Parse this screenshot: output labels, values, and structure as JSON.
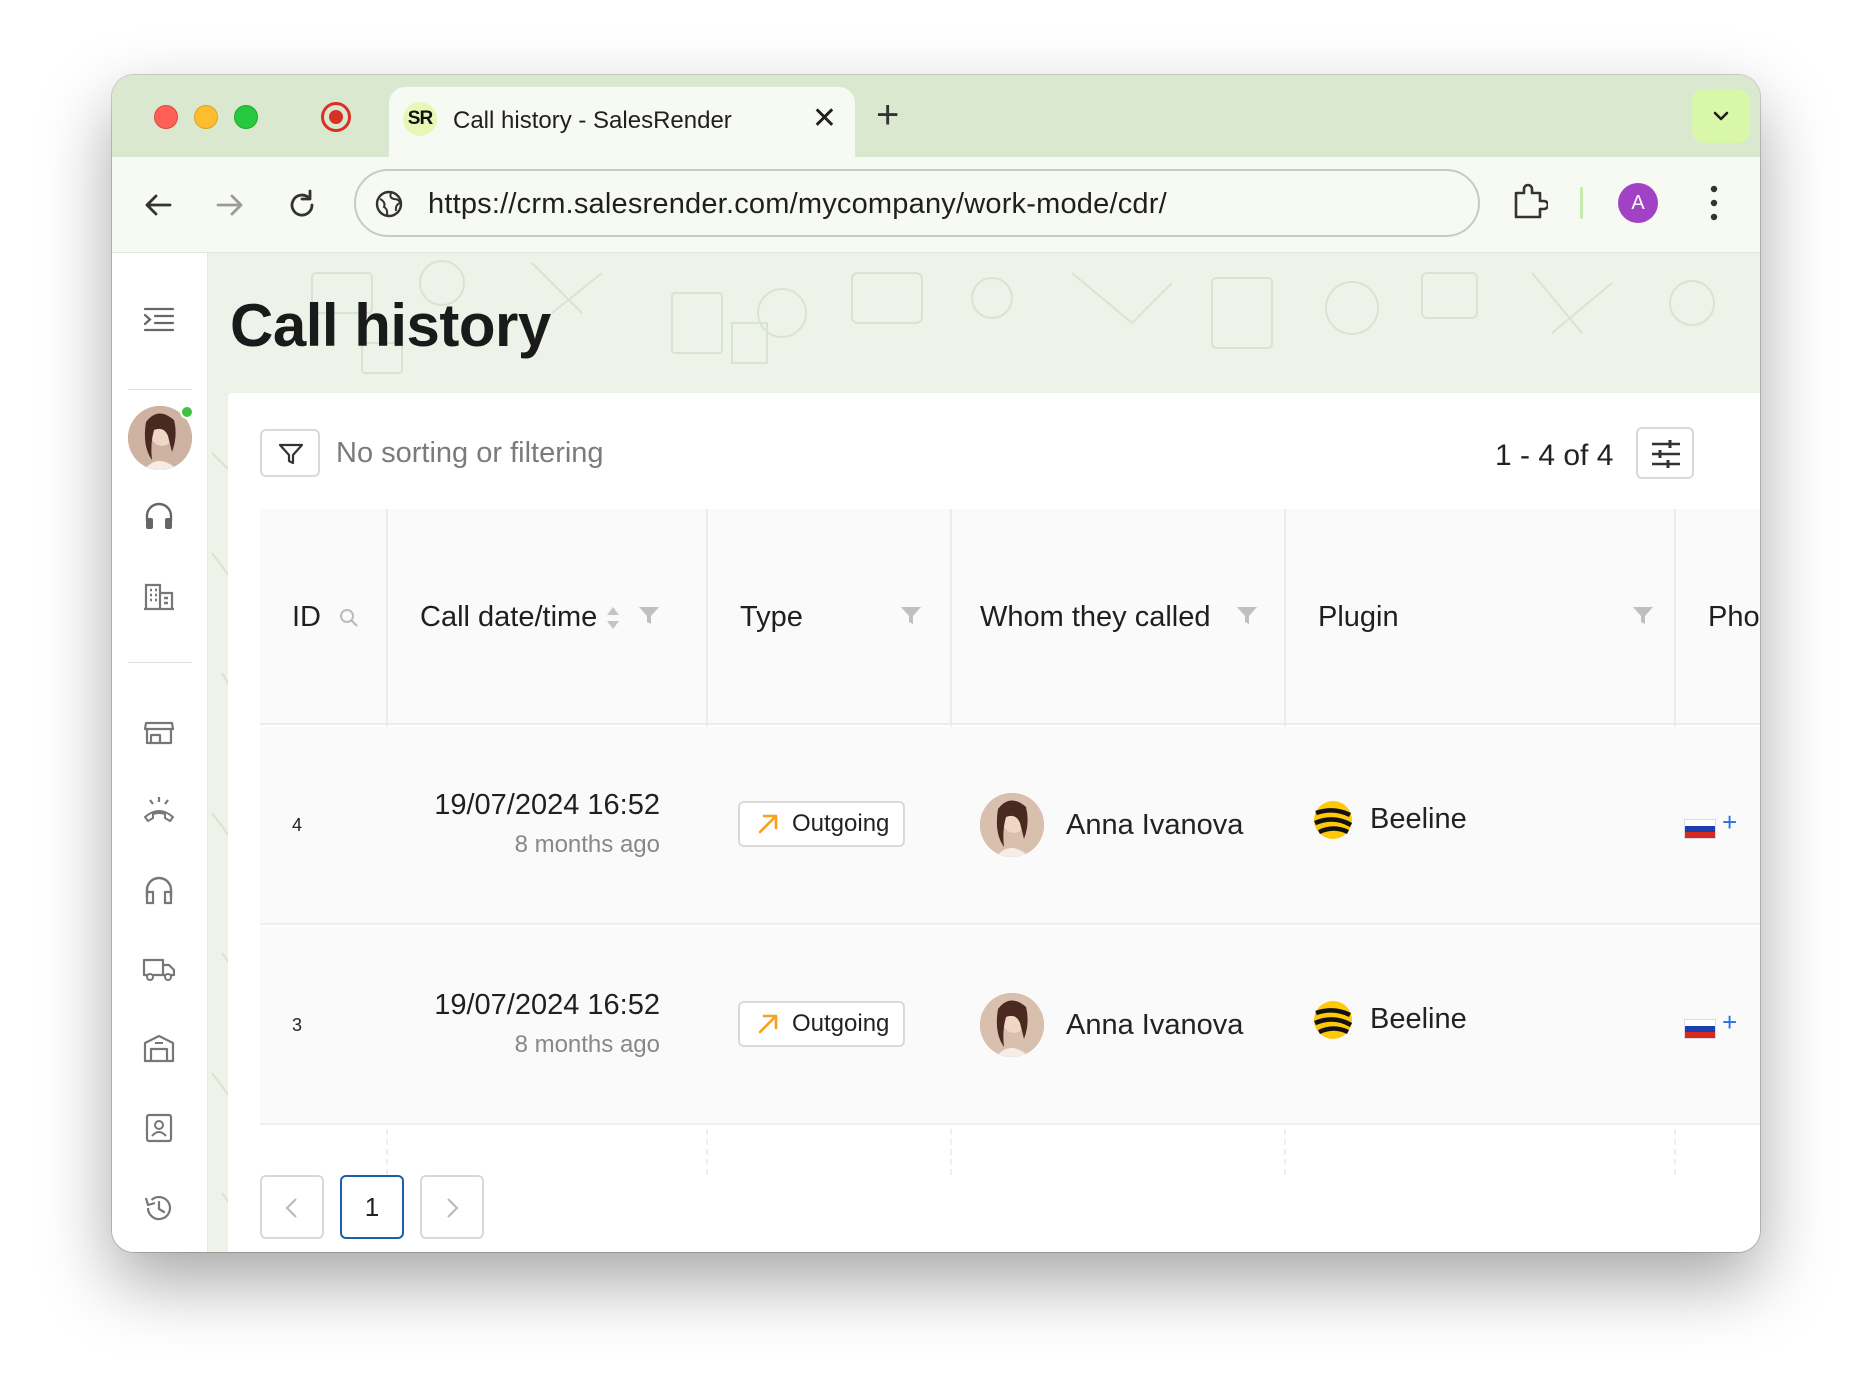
{
  "browser": {
    "tab_favicon": "SR",
    "tab_title": "Call history - SalesRender",
    "tab_close": "✕",
    "new_tab": "+",
    "url": "https://crm.salesrender.com/mycompany/work-mode/cdr/",
    "profile_initial": "A"
  },
  "page": {
    "title": "Call history",
    "filter_status": "No sorting or filtering",
    "range": "1 - 4 of 4"
  },
  "table": {
    "columns": [
      "ID",
      "Call date/time",
      "Type",
      "Whom they called",
      "Plugin",
      "Pho"
    ],
    "rows": [
      {
        "id": "4",
        "date": "19/07/2024 16:52",
        "ago": "8 months ago",
        "type": "Outgoing",
        "whom": "Anna Ivanova",
        "plugin": "Beeline",
        "phone_prefix": "+"
      },
      {
        "id": "3",
        "date": "19/07/2024 16:52",
        "ago": "8 months ago",
        "type": "Outgoing",
        "whom": "Anna Ivanova",
        "plugin": "Beeline",
        "phone_prefix": "+"
      }
    ]
  },
  "pagination": {
    "current_page": "1"
  },
  "colors": {
    "tabstrip": "#dbe8d0",
    "accent_green": "#d9f7a8",
    "outgoing_arrow": "#f5a020",
    "profile": "#a142c5",
    "pager_active": "#1b5fa8"
  },
  "icons": {
    "sidebar": [
      "menu-collapse-icon",
      "headset-icon",
      "building-icon",
      "store-icon",
      "call-end-icon",
      "headphones-icon",
      "truck-icon",
      "warehouse-icon",
      "contact-card-icon",
      "history-icon"
    ]
  }
}
